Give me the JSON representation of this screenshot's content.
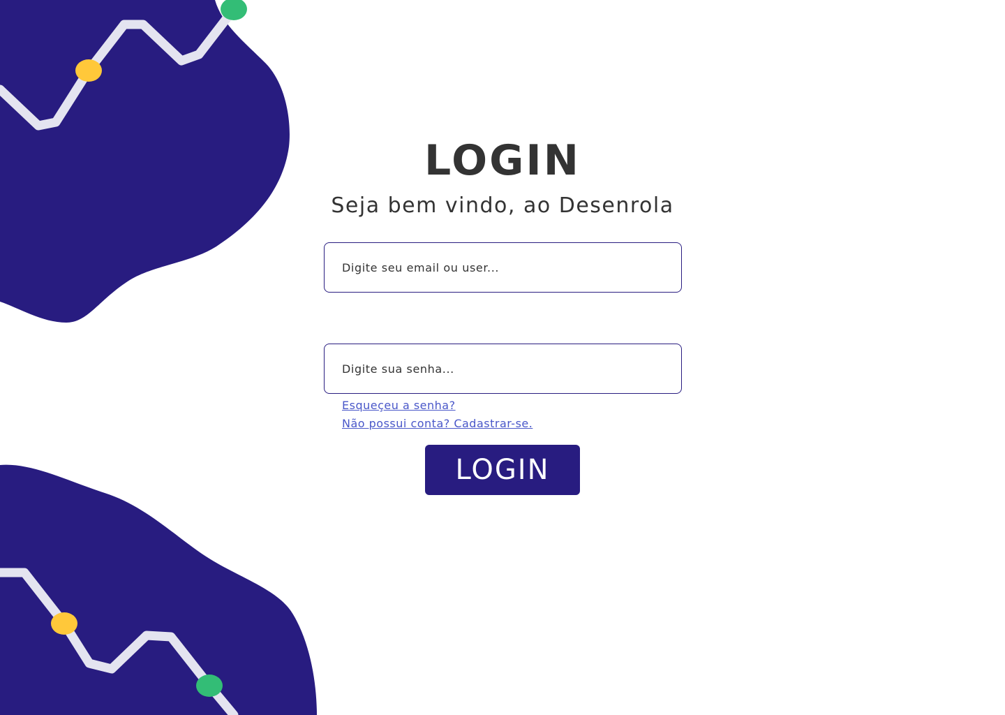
{
  "header": {
    "title": "LOGIN",
    "subtitle": "Seja bem vindo, ao Desenrola"
  },
  "form": {
    "email_placeholder": "Digite seu email ou user...",
    "password_placeholder": "Digite sua senha...",
    "forgot_password_link": "Esqueçeu a senha?",
    "signup_link": "Não possui conta? Cadastrar-se.",
    "submit_label": "LOGIN"
  },
  "colors": {
    "brand_primary": "#281C80",
    "link": "#4957C9",
    "text": "#333333",
    "accent_yellow": "#FFC83A",
    "accent_green": "#33BD76",
    "line_light": "#E4E4F0"
  }
}
